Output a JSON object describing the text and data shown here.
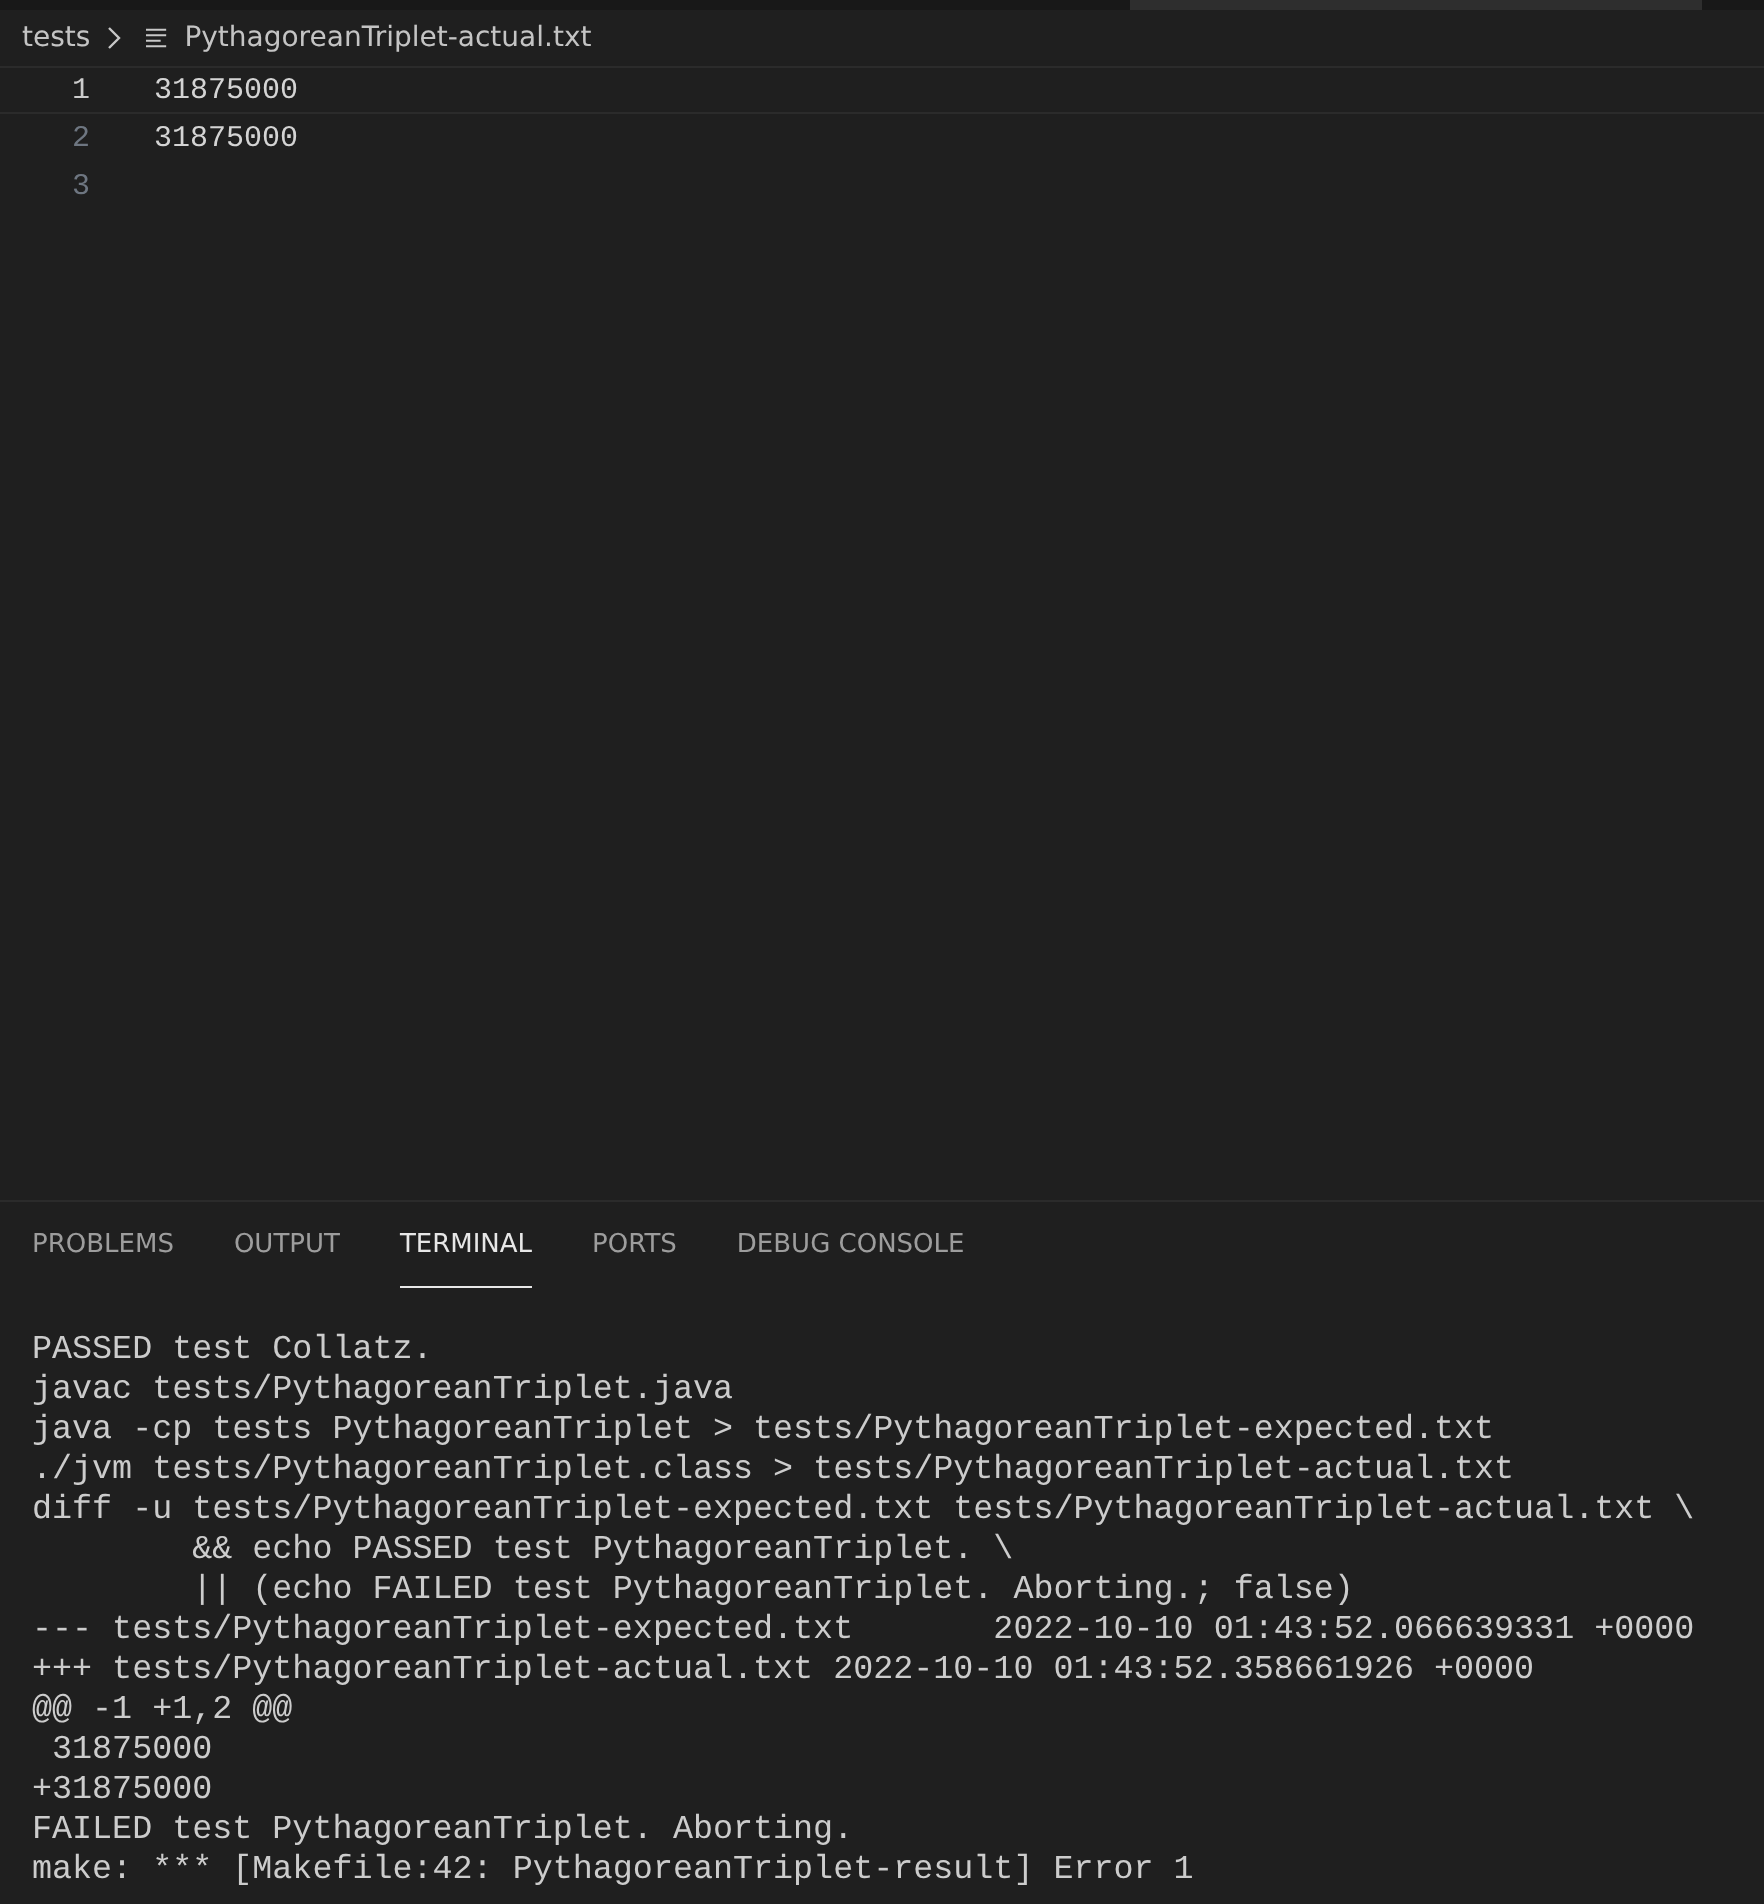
{
  "breadcrumb": {
    "folder": "tests",
    "file": "PythagoreanTriplet-actual.txt"
  },
  "editor": {
    "lines": [
      {
        "number": "1",
        "text": "31875000",
        "current": true
      },
      {
        "number": "2",
        "text": "31875000",
        "current": false
      },
      {
        "number": "3",
        "current": false
      }
    ]
  },
  "panel": {
    "tabs": [
      {
        "label": "PROBLEMS",
        "selected": false
      },
      {
        "label": "OUTPUT",
        "selected": false
      },
      {
        "label": "TERMINAL",
        "selected": true
      },
      {
        "label": "PORTS",
        "selected": false
      },
      {
        "label": "DEBUG CONSOLE",
        "selected": false
      }
    ],
    "terminal_lines": [
      "PASSED test Collatz.",
      "javac tests/PythagoreanTriplet.java",
      "java -cp tests PythagoreanTriplet > tests/PythagoreanTriplet-expected.txt",
      "./jvm tests/PythagoreanTriplet.class > tests/PythagoreanTriplet-actual.txt",
      "diff -u tests/PythagoreanTriplet-expected.txt tests/PythagoreanTriplet-actual.txt \\",
      "        && echo PASSED test PythagoreanTriplet. \\",
      "        || (echo FAILED test PythagoreanTriplet. Aborting.; false)",
      "--- tests/PythagoreanTriplet-expected.txt       2022-10-10 01:43:52.066639331 +0000",
      "+++ tests/PythagoreanTriplet-actual.txt 2022-10-10 01:43:52.358661926 +0000",
      "@@ -1 +1,2 @@",
      " 31875000",
      "+31875000",
      "FAILED test PythagoreanTriplet. Aborting.",
      "make: *** [Makefile:42: PythagoreanTriplet-result] Error 1"
    ]
  }
}
